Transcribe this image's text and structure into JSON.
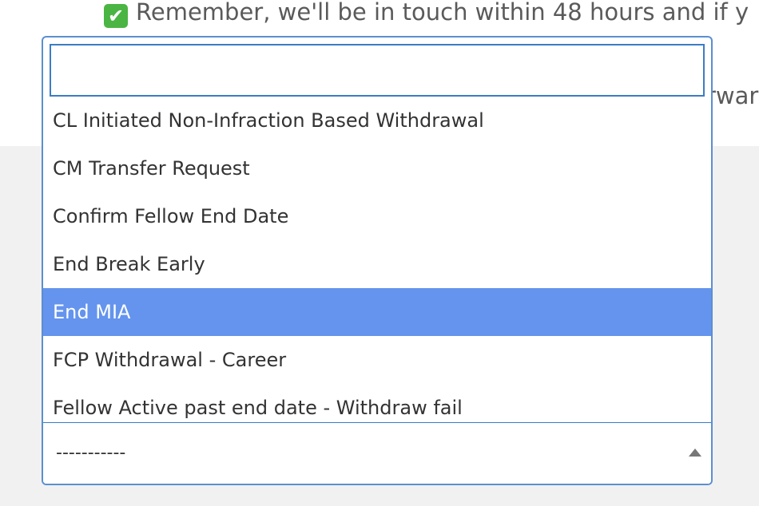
{
  "notice": {
    "icon": "check-mark-icon",
    "icon_glyph": "✔",
    "text": "Remember, we'll be in touch within 48 hours and if y",
    "partial_right": "rwar"
  },
  "dropdown": {
    "search": {
      "value": "",
      "placeholder": ""
    },
    "options": [
      {
        "label": "CL Initiated Non-Infraction Based Withdrawal",
        "highlighted": false
      },
      {
        "label": "CM Transfer Request",
        "highlighted": false
      },
      {
        "label": "Confirm Fellow End Date",
        "highlighted": false
      },
      {
        "label": "End Break Early",
        "highlighted": false
      },
      {
        "label": "End MIA",
        "highlighted": true
      },
      {
        "label": "FCP Withdrawal - Career",
        "highlighted": false
      },
      {
        "label": "Fellow Active past end date - Withdraw fail",
        "highlighted": false
      }
    ],
    "selected_value": "-----------",
    "arrow_icon": "caret-up-icon"
  },
  "colors": {
    "highlight": "#6494ed",
    "border": "#5b8fcf",
    "check_green": "#4bb543"
  }
}
